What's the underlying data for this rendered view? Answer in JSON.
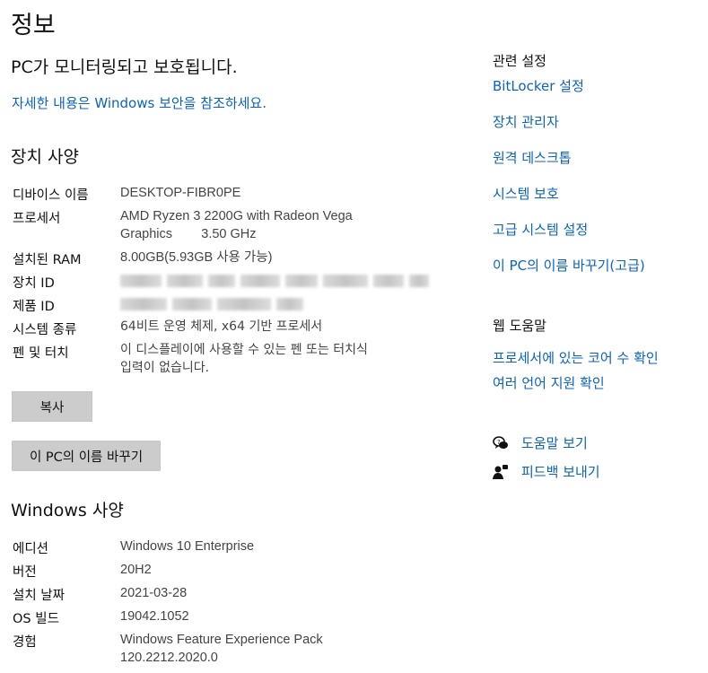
{
  "page": {
    "title": "정보",
    "status": "PC가 모니터링되고 보호됩니다.",
    "learn_more_link": "자세한 내용은 Windows 보안을 참조하세요."
  },
  "device_specs": {
    "title": "장치 사양",
    "device_name": {
      "label": "디바이스 이름",
      "value": "DESKTOP-FIBR0PE"
    },
    "processor": {
      "label": "프로세서",
      "value_line1": "AMD Ryzen 3 2200G with Radeon Vega",
      "value_line2": "Graphics        3.50 GHz"
    },
    "ram": {
      "label": "설치된 RAM",
      "value": "8.00GB(5.93GB 사용 가능)"
    },
    "device_id": {
      "label": "장치 ID"
    },
    "product_id": {
      "label": "제품 ID"
    },
    "system_type": {
      "label": "시스템 종류",
      "value": "64비트 운영 체제, x64 기반 프로세서"
    },
    "pen_touch": {
      "label": "펜 및 터치",
      "value_line1": "이 디스플레이에 사용할 수 있는 펜 또는 터치식",
      "value_line2": "입력이 없습니다."
    },
    "copy_button": "복사",
    "rename_button": "이 PC의 이름 바꾸기"
  },
  "windows_specs": {
    "title": "Windows 사양",
    "edition": {
      "label": "에디션",
      "value": "Windows 10 Enterprise"
    },
    "version": {
      "label": "버전",
      "value": "20H2"
    },
    "install_date": {
      "label": "설치 날짜",
      "value": "2021-03-28"
    },
    "os_build": {
      "label": "OS 빌드",
      "value": "19042.1052"
    },
    "experience": {
      "label": "경험",
      "value_line1": "Windows Feature Experience Pack",
      "value_line2": "120.2212.2020.0"
    }
  },
  "related_settings": {
    "heading": "관련 설정",
    "links": [
      "BitLocker 설정",
      "장치 관리자",
      "원격 데스크톱",
      "시스템 보호",
      "고급 시스템 설정",
      "이 PC의 이름 바꾸기(고급)"
    ]
  },
  "web_help": {
    "heading": "웹 도움말",
    "links": [
      "프로세서에 있는 코어 수 확인",
      "여러 언어 지원 확인"
    ]
  },
  "help_actions": {
    "get_help": "도움말 보기",
    "feedback": "피드백 보내기"
  },
  "colors": {
    "link": "#0a62c2",
    "button_bg": "#cccccc"
  }
}
